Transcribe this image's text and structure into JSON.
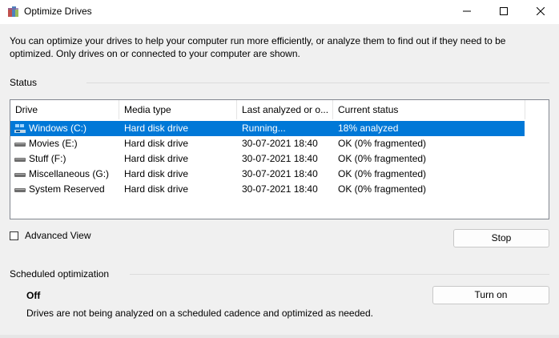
{
  "window": {
    "title": "Optimize Drives",
    "app_icon": "optimize-drives-icon",
    "controls": [
      "minimize-icon",
      "maximize-icon",
      "close-icon"
    ]
  },
  "description": "You can optimize your drives to help your computer run more efficiently, or analyze them to find out if they need to be optimized. Only drives on or connected to your computer are shown.",
  "status": {
    "label": "Status",
    "columns": [
      "Drive",
      "Media type",
      "Last analyzed or o...",
      "Current status"
    ],
    "rows": [
      {
        "drive": "Windows (C:)",
        "media": "Hard disk drive",
        "last": "Running...",
        "status": "18% analyzed",
        "selected": true,
        "icon": "windows-drive-icon"
      },
      {
        "drive": "Movies (E:)",
        "media": "Hard disk drive",
        "last": "30-07-2021 18:40",
        "status": "OK (0% fragmented)",
        "selected": false,
        "icon": "hard-drive-icon"
      },
      {
        "drive": "Stuff (F:)",
        "media": "Hard disk drive",
        "last": "30-07-2021 18:40",
        "status": "OK (0% fragmented)",
        "selected": false,
        "icon": "hard-drive-icon"
      },
      {
        "drive": "Miscellaneous (G:)",
        "media": "Hard disk drive",
        "last": "30-07-2021 18:40",
        "status": "OK (0% fragmented)",
        "selected": false,
        "icon": "hard-drive-icon"
      },
      {
        "drive": "System Reserved",
        "media": "Hard disk drive",
        "last": "30-07-2021 18:40",
        "status": "OK (0% fragmented)",
        "selected": false,
        "icon": "hard-drive-icon"
      }
    ]
  },
  "advanced_view": {
    "label": "Advanced View",
    "checked": false
  },
  "stop_button": "Stop",
  "scheduled": {
    "label": "Scheduled optimization",
    "state": "Off",
    "text": "Drives are not being analyzed on a scheduled cadence and optimized as needed.",
    "button": "Turn on"
  },
  "colors": {
    "selection": "#0078d7",
    "window_bg": "#f0f0f0"
  }
}
